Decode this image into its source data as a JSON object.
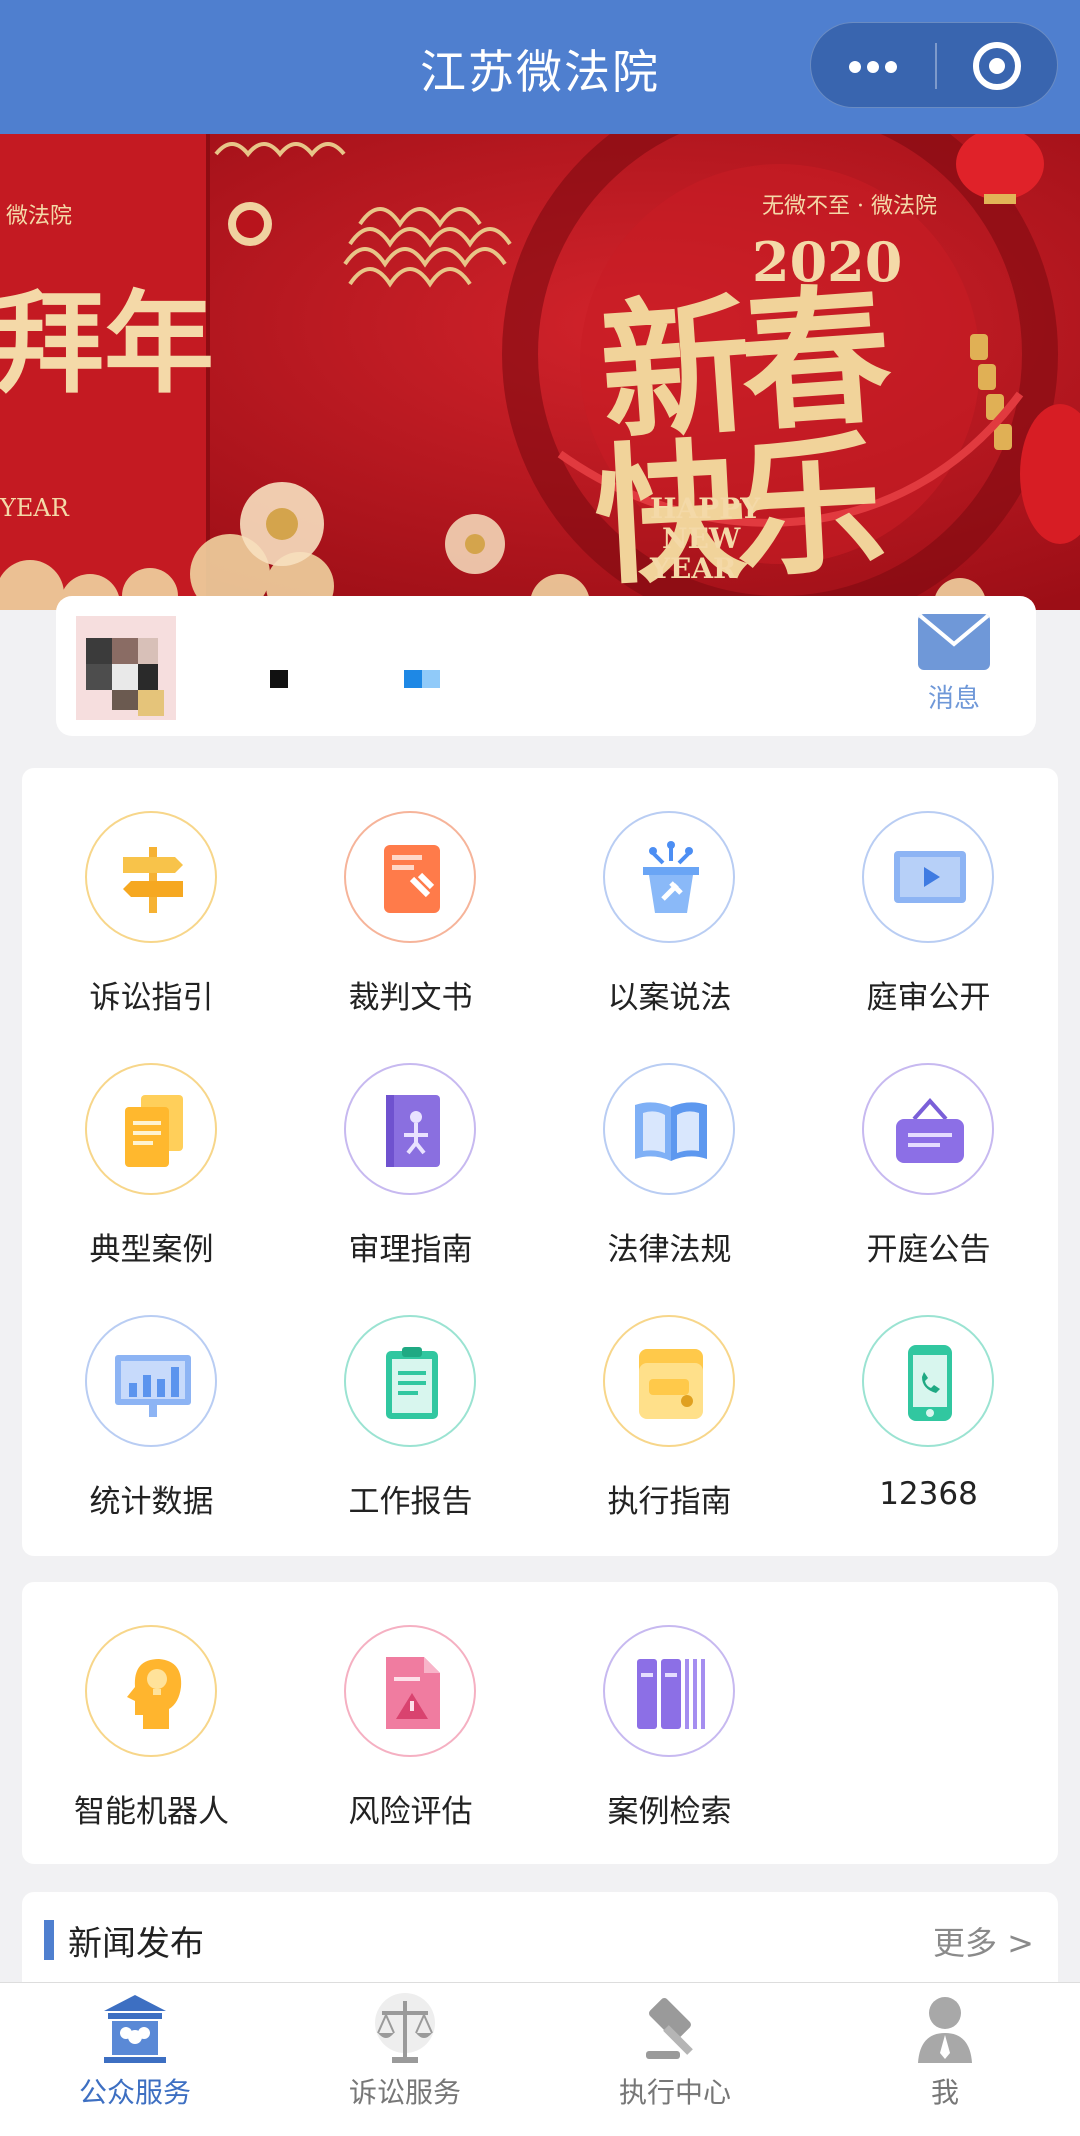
{
  "nav": {
    "title": "江苏微法院"
  },
  "banner": {
    "left_slide": {
      "top_text": "微法院",
      "big_text": "拜年",
      "year_text": "YEAR"
    },
    "main_slide": {
      "slogan": "无微不至 · 微法院",
      "year": "2020",
      "line1": "新春",
      "line2": "快乐",
      "english_1": "HAPPY",
      "english_2": "NEW",
      "english_3": "YEAR"
    }
  },
  "user": {
    "message_label": "消息"
  },
  "services": [
    {
      "label": "诉讼指引",
      "icon": "signpost-icon"
    },
    {
      "label": "裁判文书",
      "icon": "judgment-document-icon"
    },
    {
      "label": "以案说法",
      "icon": "podium-icon"
    },
    {
      "label": "庭审公开",
      "icon": "video-screen-icon"
    },
    {
      "label": "典型案例",
      "icon": "documents-icon"
    },
    {
      "label": "审理指南",
      "icon": "guide-book-icon"
    },
    {
      "label": "法律法规",
      "icon": "open-book-icon"
    },
    {
      "label": "开庭公告",
      "icon": "hanging-sign-icon"
    },
    {
      "label": "统计数据",
      "icon": "bar-chart-board-icon"
    },
    {
      "label": "工作报告",
      "icon": "clipboard-icon"
    },
    {
      "label": "执行指南",
      "icon": "folder-icon"
    },
    {
      "label": "12368",
      "icon": "phone-icon"
    }
  ],
  "tools": [
    {
      "label": "智能机器人",
      "icon": "robot-head-icon"
    },
    {
      "label": "风险评估",
      "icon": "risk-warning-icon"
    },
    {
      "label": "案例检索",
      "icon": "case-binders-icon"
    }
  ],
  "news": {
    "title": "新闻发布",
    "more": "更多 >"
  },
  "tabs": [
    {
      "label": "公众服务",
      "icon": "courthouse-icon",
      "active": true
    },
    {
      "label": "诉讼服务",
      "icon": "scales-icon",
      "active": false
    },
    {
      "label": "执行中心",
      "icon": "gavel-icon",
      "active": false
    },
    {
      "label": "我",
      "icon": "person-icon",
      "active": false
    }
  ],
  "colors": {
    "primary": "#4f7fcf",
    "active_tab": "#3d6fc2",
    "banner_red": "#b8141c",
    "gold": "#f1d39a"
  }
}
